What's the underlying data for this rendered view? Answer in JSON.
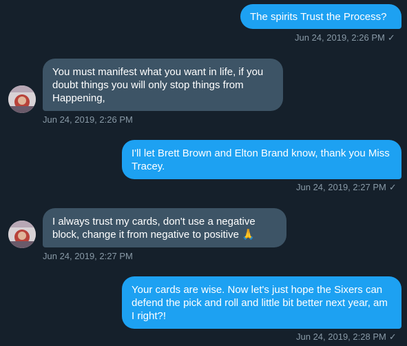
{
  "conversation": {
    "messages": [
      {
        "direction": "out",
        "text": "The spirits Trust the Process?",
        "timestamp": "Jun 24, 2019, 2:26 PM",
        "read_mark": "✓"
      },
      {
        "direction": "in",
        "text": "You must manifest what you want in life, if you doubt things you will only stop things from Happening,",
        "timestamp": "Jun 24, 2019, 2:26 PM"
      },
      {
        "direction": "out",
        "text": "I'll let Brett Brown and Elton Brand know, thank you Miss Tracey.",
        "timestamp": "Jun 24, 2019, 2:27 PM",
        "read_mark": "✓"
      },
      {
        "direction": "in",
        "text": "I always trust my cards, don't use a negative block, change it from negative to positive 🙏",
        "timestamp": "Jun 24, 2019, 2:27 PM"
      },
      {
        "direction": "out",
        "text": "Your cards are wise. Now let's just hope the Sixers can defend the pick and roll and little bit better next year, am I right?!",
        "timestamp": "Jun 24, 2019, 2:28 PM",
        "read_mark": "✓"
      }
    ]
  },
  "colors": {
    "background": "#15202b",
    "outgoing_bubble": "#1da1f2",
    "incoming_bubble": "#3d5466",
    "timestamp": "#8899a6"
  },
  "icons": {
    "avatar": "avatar-icon",
    "read": "check-icon"
  }
}
